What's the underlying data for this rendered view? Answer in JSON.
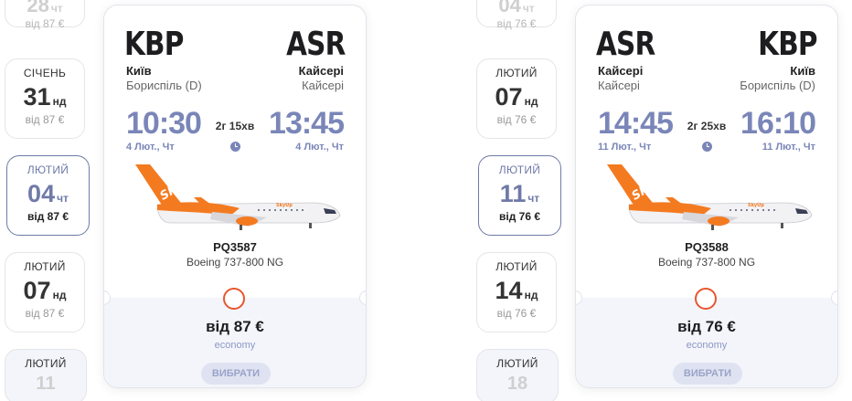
{
  "panels": [
    {
      "dates": [
        {
          "month": "",
          "day": "28",
          "dow": "чт",
          "price": "від 87 €",
          "kind": "partial-top"
        },
        {
          "month": "СІЧЕНЬ",
          "day": "31",
          "dow": "нд",
          "price": "від 87 €",
          "kind": "normal"
        },
        {
          "month": "ЛЮТИЙ",
          "day": "04",
          "dow": "чт",
          "price": "від 87 €",
          "kind": "active"
        },
        {
          "month": "ЛЮТИЙ",
          "day": "07",
          "dow": "нд",
          "price": "від 87 €",
          "kind": "normal"
        },
        {
          "month": "ЛЮТИЙ",
          "day": "11",
          "dow": "",
          "price": "",
          "kind": "partial-bottom"
        }
      ],
      "flight": {
        "from_code": "KBP",
        "to_code": "ASR",
        "from_city": "Київ",
        "to_city": "Кайсері",
        "from_airport": "Бориспіль (D)",
        "to_airport": "Кайсері",
        "dep_time": "10:30",
        "arr_time": "13:45",
        "dep_date": "4 Лют., Чт",
        "arr_date": "4 Лют., Чт",
        "duration": "2г 15хв",
        "flight_no": "PQ3587",
        "aircraft": "Boeing 737-800 NG",
        "price": "від 87 €",
        "fare_class": "economy",
        "button": "ВИБРАТИ",
        "airline_logo_text": "SkyUp"
      }
    },
    {
      "dates": [
        {
          "month": "",
          "day": "04",
          "dow": "чт",
          "price": "від 76 €",
          "kind": "partial-top"
        },
        {
          "month": "ЛЮТИЙ",
          "day": "07",
          "dow": "нд",
          "price": "від 76 €",
          "kind": "normal"
        },
        {
          "month": "ЛЮТИЙ",
          "day": "11",
          "dow": "чт",
          "price": "від 76 €",
          "kind": "active"
        },
        {
          "month": "ЛЮТИЙ",
          "day": "14",
          "dow": "нд",
          "price": "від 76 €",
          "kind": "normal"
        },
        {
          "month": "ЛЮТИЙ",
          "day": "18",
          "dow": "",
          "price": "",
          "kind": "partial-bottom"
        }
      ],
      "flight": {
        "from_code": "ASR",
        "to_code": "KBP",
        "from_city": "Кайсері",
        "to_city": "Київ",
        "from_airport": "Кайсері",
        "to_airport": "Бориспіль (D)",
        "dep_time": "14:45",
        "arr_time": "16:10",
        "dep_date": "11 Лют., Чт",
        "arr_date": "11 Лют., Чт",
        "duration": "2г 25хв",
        "flight_no": "PQ3588",
        "aircraft": "Boeing 737-800 NG",
        "price": "від 76 €",
        "fare_class": "economy",
        "button": "ВИБРАТИ",
        "airline_logo_text": "SkyUp"
      }
    }
  ],
  "colors": {
    "accent": "#7a86b8",
    "brand_orange": "#f47a20",
    "radio": "#e8562e",
    "card_bottom": "#f3f5fb"
  }
}
